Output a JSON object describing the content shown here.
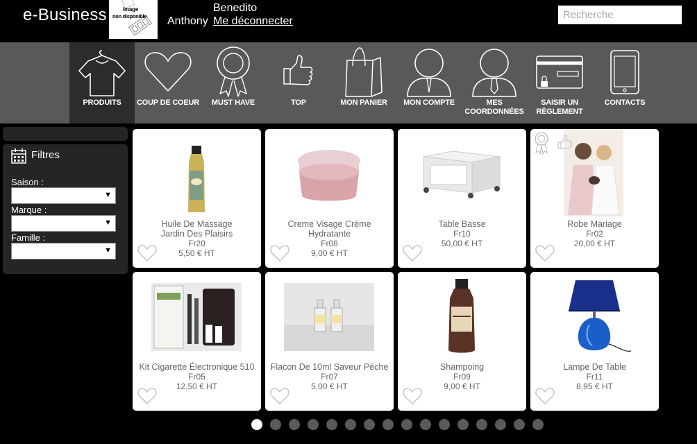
{
  "header": {
    "brand": "e-Business",
    "logo_line1": "Image",
    "logo_line2": "non disponible",
    "user_first_name": "Benedito",
    "user_last_name": "Anthony",
    "logout_label": "Me déconnecter",
    "search_placeholder": "Recherche"
  },
  "nav": {
    "items": [
      {
        "label": "PRODUITS",
        "icon": "tshirt-icon",
        "active": true
      },
      {
        "label": "COUP DE COEUR",
        "icon": "heart-icon",
        "active": false
      },
      {
        "label": "MUST HAVE",
        "icon": "award-ribbon-icon",
        "active": false
      },
      {
        "label": "TOP",
        "icon": "thumbs-up-icon",
        "active": false
      },
      {
        "label": "MON PANIER",
        "icon": "shopping-bag-icon",
        "active": false
      },
      {
        "label": "MON COMPTE",
        "icon": "user-icon",
        "active": false
      },
      {
        "label": "MES COORDONNÉES",
        "icon": "user-tie-icon",
        "active": false
      },
      {
        "label": "SAISIR UN RÈGLEMENT",
        "icon": "credit-card-lock-icon",
        "active": false
      },
      {
        "label": "CONTACTS",
        "icon": "smartphone-icon",
        "active": false
      }
    ]
  },
  "filters": {
    "title": "Filtres",
    "saison_label": "Saison :",
    "marque_label": "Marque :",
    "famille_label": "Famille :",
    "saison_value": "",
    "marque_value": "",
    "famille_value": ""
  },
  "products": [
    {
      "name": "Huile De Massage Jardin Des Plaisirs",
      "ref": "Fr20",
      "price": "5,50 € HT"
    },
    {
      "name": "Creme Visage Crème Hydratante",
      "ref": "Fr08",
      "price": "9,00 € HT"
    },
    {
      "name": "Table Basse",
      "ref": "Fr10",
      "price": "50,00 € HT"
    },
    {
      "name": "Robe Mariage",
      "ref": "Fr02",
      "price": "20,00 € HT"
    },
    {
      "name": "Kit Cigarette Électronique 510",
      "ref": "Fr05",
      "price": "12,50 € HT"
    },
    {
      "name": "Flacon De 10ml Saveur Pêche",
      "ref": "Fr07",
      "price": "5,00 € HT"
    },
    {
      "name": "Shampoing",
      "ref": "Fr09",
      "price": "9,00 € HT"
    },
    {
      "name": "Lampe De Table",
      "ref": "Fr11",
      "price": "8,95 € HT"
    }
  ],
  "pagination": {
    "pages": 16,
    "current": 1
  },
  "colors": {
    "background": "#000000",
    "navbar": "#595959",
    "nav_active": "#2c2c2c",
    "panel": "#252525",
    "card_text": "#666666"
  }
}
